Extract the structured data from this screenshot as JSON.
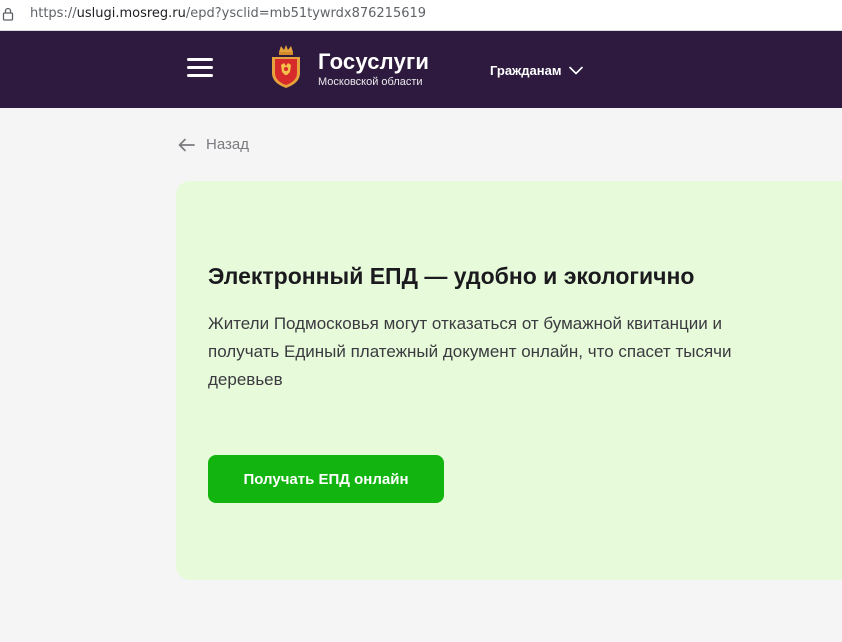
{
  "browser": {
    "url_prefix": "https://",
    "url_domain": "uslugi.mosreg.ru",
    "url_path": "/epd?ysclid=mb51tywrdx876215619"
  },
  "header": {
    "menu_icon": "hamburger-menu-icon",
    "emblem_icon": "moscow-oblast-coat-of-arms",
    "brand_title": "Госуслуги",
    "brand_subtitle": "Московской области",
    "nav_citizens": "Гражданам",
    "background_color": "#2d1a3e"
  },
  "back": {
    "label": "Назад",
    "icon": "arrow-left-icon"
  },
  "card": {
    "title": "Электронный ЕПД — удобно и экологично",
    "text": "Жители Подмосковья могут отказаться от бумажной квитанции и получать Единый платежный документ онлайн, что спасет тысячи деревьев",
    "button_label": "Получать ЕПД онлайн",
    "background_color": "#e7fad9",
    "button_color": "#12b50f"
  }
}
